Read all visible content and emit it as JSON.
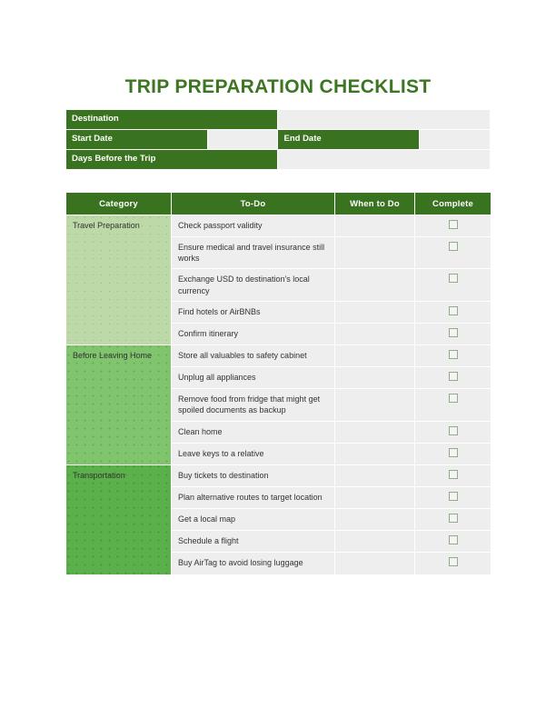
{
  "document": {
    "title": "TRIP PREPARATION CHECKLIST"
  },
  "colors": {
    "header_green": "#3a7320",
    "title_green": "#3c7622",
    "blank_gray": "#eeeeee",
    "category_1_green": "#bcd9a7",
    "category_2_green": "#80c46d",
    "category_3_green": "#5cb04b",
    "checkbox_border": "#8fae84"
  },
  "info": {
    "destination_label": "Destination",
    "destination_value": "",
    "start_date_label": "Start Date",
    "start_date_value": "",
    "end_date_label": "End Date",
    "end_date_value": "",
    "days_before_label": "Days Before the Trip",
    "days_before_value": ""
  },
  "checklist": {
    "columns": {
      "category": "Category",
      "todo": "To-Do",
      "when": "When to Do",
      "complete": "Complete"
    },
    "sections": [
      {
        "category": "Travel Preparation",
        "rows": [
          {
            "todo": "Check passport validity",
            "when": "",
            "complete": ""
          },
          {
            "todo": "Ensure medical and travel insurance still works",
            "when": "",
            "complete": ""
          },
          {
            "todo": "Exchange USD to destination's local currency",
            "when": "",
            "complete": ""
          },
          {
            "todo": "Find hotels or AirBNBs",
            "when": "",
            "complete": ""
          },
          {
            "todo": "Confirm itinerary",
            "when": "",
            "complete": ""
          }
        ]
      },
      {
        "category": "Before Leaving Home",
        "rows": [
          {
            "todo": "Store all valuables to safety cabinet",
            "when": "",
            "complete": ""
          },
          {
            "todo": "Unplug all appliances",
            "when": "",
            "complete": ""
          },
          {
            "todo": "Remove food from fridge that might get spoiled documents as backup",
            "when": "",
            "complete": ""
          },
          {
            "todo": "Clean home",
            "when": "",
            "complete": ""
          },
          {
            "todo": "Leave keys to a relative",
            "when": "",
            "complete": ""
          }
        ]
      },
      {
        "category": "Transportation",
        "rows": [
          {
            "todo": "Buy tickets to destination",
            "when": "",
            "complete": ""
          },
          {
            "todo": "Plan alternative routes to target location",
            "when": "",
            "complete": ""
          },
          {
            "todo": "Get a local map",
            "when": "",
            "complete": ""
          },
          {
            "todo": "Schedule a flight",
            "when": "",
            "complete": ""
          },
          {
            "todo": "Buy AirTag to avoid losing luggage",
            "when": "",
            "complete": ""
          }
        ]
      }
    ]
  }
}
